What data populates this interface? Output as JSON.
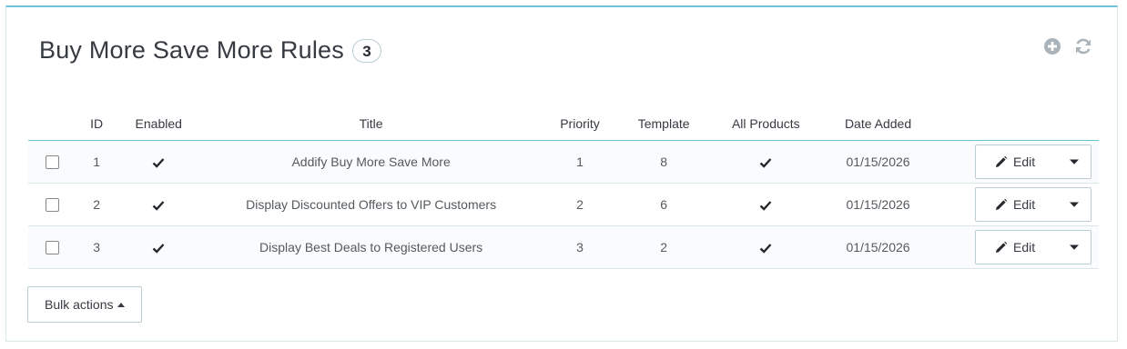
{
  "panel": {
    "title": "Buy More Save More Rules",
    "count": "3",
    "toolbar": {
      "add_icon": "plus-circle-icon",
      "refresh_icon": "refresh-icon"
    }
  },
  "table": {
    "headers": [
      "ID",
      "Enabled",
      "Title",
      "Priority",
      "Template",
      "All Products",
      "Date Added"
    ],
    "rows": [
      {
        "id": "1",
        "enabled": true,
        "title": "Addify Buy More Save More",
        "priority": "1",
        "template": "8",
        "all_products": true,
        "date_added": "01/15/2026",
        "edit_label": "Edit"
      },
      {
        "id": "2",
        "enabled": true,
        "title": "Display Discounted Offers to VIP Customers",
        "priority": "2",
        "template": "6",
        "all_products": true,
        "date_added": "01/15/2026",
        "edit_label": "Edit"
      },
      {
        "id": "3",
        "enabled": true,
        "title": "Display Best Deals to Registered Users",
        "priority": "3",
        "template": "2",
        "all_products": true,
        "date_added": "01/15/2026",
        "edit_label": "Edit"
      }
    ]
  },
  "bulk_actions": {
    "label": "Bulk actions"
  },
  "colors": {
    "accent": "#6ec3d9",
    "border": "#bbcdd2",
    "text": "#363a41"
  }
}
